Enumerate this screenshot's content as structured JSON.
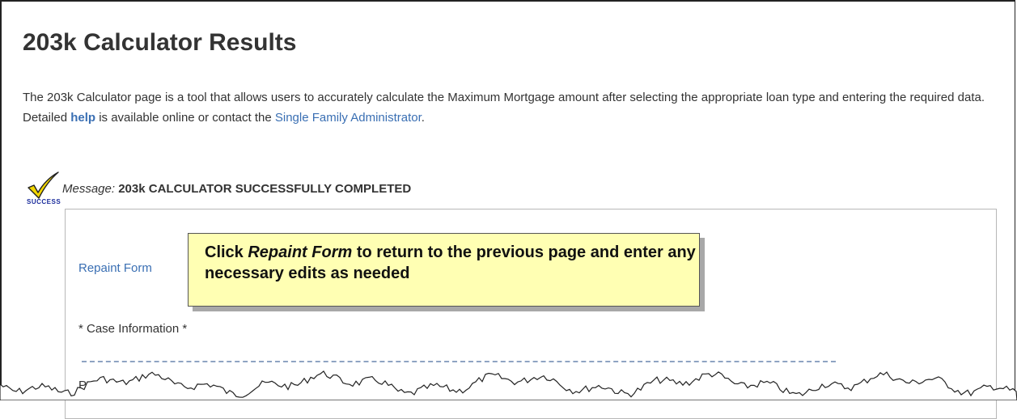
{
  "page": {
    "title": "203k Calculator Results",
    "intro_part1": "The 203k Calculator page is a tool that allows users to accurately calculate the Maximum Mortgage amount after selecting the appropriate loan type and entering the required data. Detailed ",
    "help_link": "help",
    "intro_part2": " is available online or contact the ",
    "admin_link": "Single Family Administrator",
    "intro_part3": "."
  },
  "status": {
    "icon_text": "SUCCESS",
    "message_label": "Message:",
    "message_text": "203k CALCULATOR SUCCESSFULLY COMPLETED"
  },
  "form": {
    "repaint_link": "Repaint Form",
    "case_info_heading": "* Case Information *",
    "property_address_label": "Property Address:"
  },
  "callout": {
    "prefix": "Click ",
    "emphasis": "Repaint Form",
    "suffix": " to return to the previous page and enter any necessary edits as needed"
  },
  "colors": {
    "link": "#3a6fb3",
    "callout_bg": "#ffffb3",
    "check": "#f2d600",
    "success_text": "#1a2c9c"
  }
}
